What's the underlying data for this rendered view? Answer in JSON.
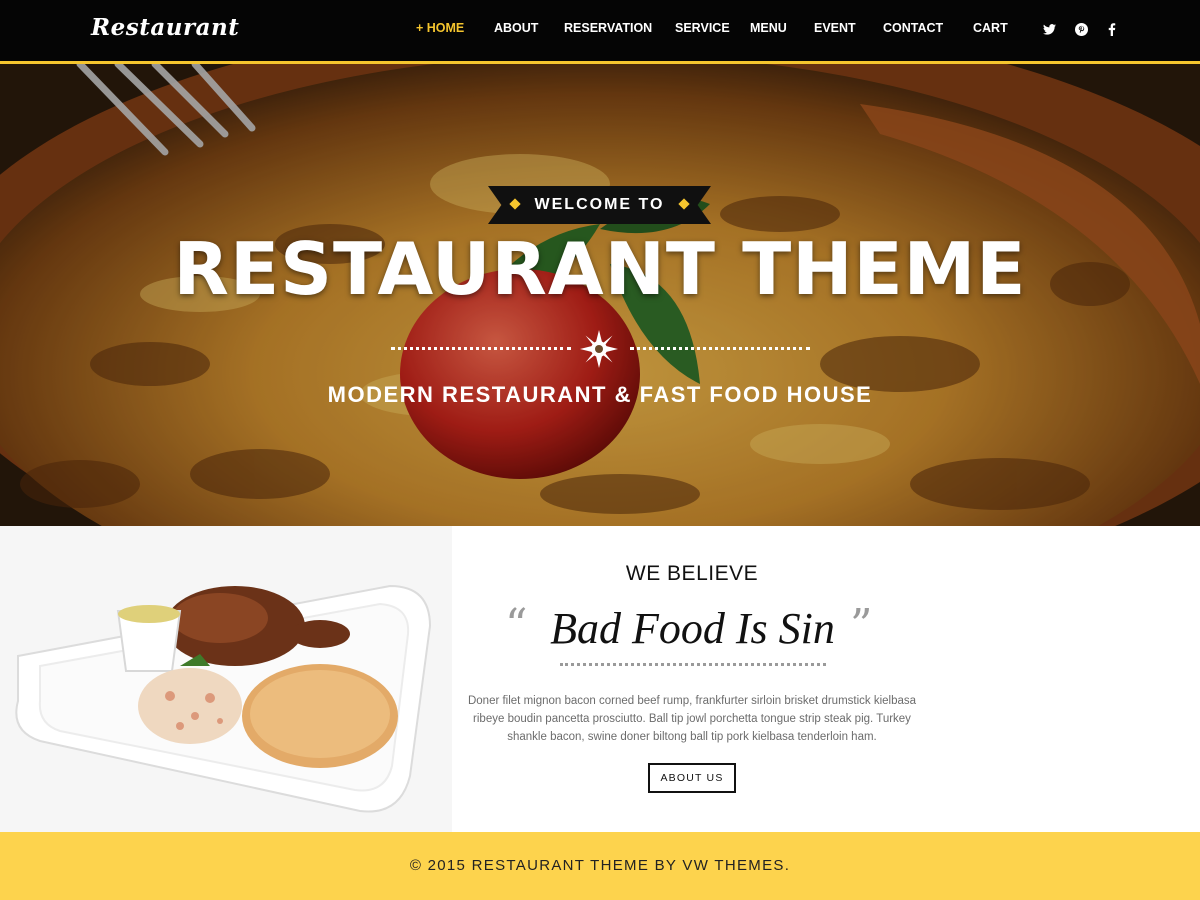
{
  "header": {
    "logo": "Restaurant",
    "nav": [
      {
        "label": "+ HOME",
        "active": true
      },
      {
        "label": "ABOUT",
        "active": false
      },
      {
        "label": "RESERVATION",
        "active": false
      },
      {
        "label": "SERVICE",
        "active": false
      },
      {
        "label": "MENU",
        "active": false
      },
      {
        "label": "EVENT",
        "active": false
      },
      {
        "label": "CONTACT",
        "active": false
      },
      {
        "label": "CART",
        "active": false
      }
    ],
    "social_icons": [
      "twitter-icon",
      "pinterest-icon",
      "facebook-icon"
    ]
  },
  "hero": {
    "welcome": "WELCOME TO",
    "title": "RESTAURANT THEME",
    "subtitle": "MODERN RESTAURANT & FAST FOOD HOUSE"
  },
  "about": {
    "heading": "WE BELIEVE",
    "quote": "Bad Food Is Sin",
    "body": "Doner filet mignon bacon corned beef rump, frankfurter sirloin brisket drumstick kielbasa ribeye boudin pancetta prosciutto. Ball tip jowl porchetta tongue strip steak pig. Turkey shankle bacon, swine doner biltong ball tip pork kielbasa tenderloin ham.",
    "button": "ABOUT US"
  },
  "footer": {
    "copyright": "© 2015 RESTAURANT THEME BY VW THEMES."
  },
  "colors": {
    "accent": "#f5c52e",
    "nav_background": "#050505",
    "footer_background": "#fdd34d"
  }
}
